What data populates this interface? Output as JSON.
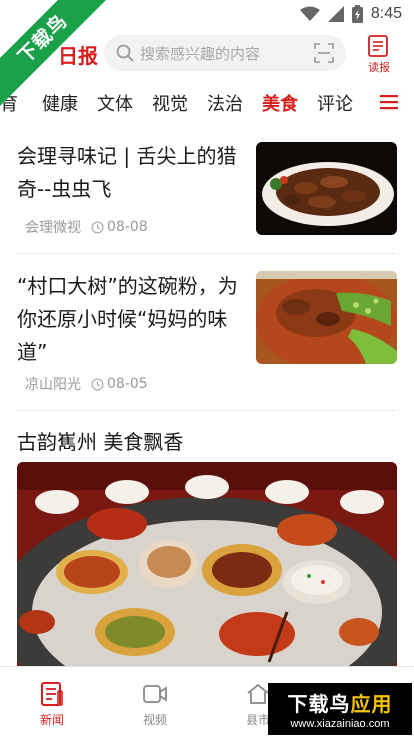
{
  "watermark": {
    "ribbon_text": "下载鸟",
    "corner_main": "下载鸟",
    "corner_suffix": "应用",
    "corner_url": "www.xiazainiao.com"
  },
  "status_bar": {
    "time": "8:45"
  },
  "header": {
    "logo_text": "日报",
    "search_placeholder": "搜索感兴趣的内容",
    "read_label": "读报"
  },
  "tabs": [
    {
      "label": "教育"
    },
    {
      "label": "健康"
    },
    {
      "label": "文体"
    },
    {
      "label": "视觉"
    },
    {
      "label": "法治"
    },
    {
      "label": "美食",
      "active": true
    },
    {
      "label": "评论"
    }
  ],
  "articles": [
    {
      "title": "会理寻味记 | 舌尖上的猎奇--虫虫飞",
      "source": "会理微视",
      "date": "08-08"
    },
    {
      "title": "“村口大树”的这碗粉，为你还原小时候“妈妈的味道”",
      "source": "凉山阳光",
      "date": "08-05"
    }
  ],
  "feature": {
    "title": "古韵嶲州 美食飘香"
  },
  "bottom_nav": [
    {
      "label": "新闻",
      "active": true
    },
    {
      "label": "视频"
    },
    {
      "label": "县市"
    }
  ],
  "colors": {
    "accent": "#d81e1e",
    "ribbon": "#1aa14a"
  }
}
